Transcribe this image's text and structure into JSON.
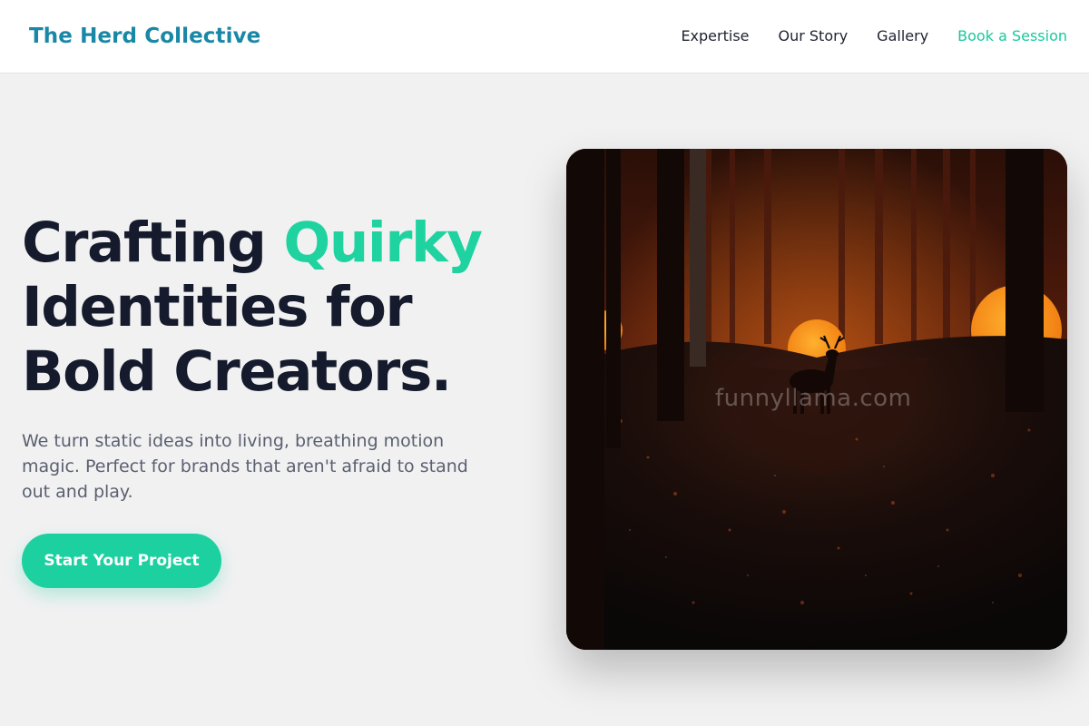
{
  "brand": {
    "name": "The Herd Collective"
  },
  "nav": {
    "items": [
      "Expertise",
      "Our Story",
      "Gallery"
    ],
    "cta": "Book a Session"
  },
  "hero": {
    "title_before": "Crafting ",
    "title_accent": "Quirky",
    "title_after": " Identities for Bold Creators.",
    "subtitle": "We turn static ideas into living, breathing motion magic. Perfect for brands that aren't afraid to stand out and play.",
    "button_label": "Start Your Project",
    "image_watermark": "funnyllama.com"
  },
  "colors": {
    "brand": "#1987a6",
    "accent": "#1fd3a0",
    "heading": "#151b2c",
    "background": "#f1f1f2"
  }
}
